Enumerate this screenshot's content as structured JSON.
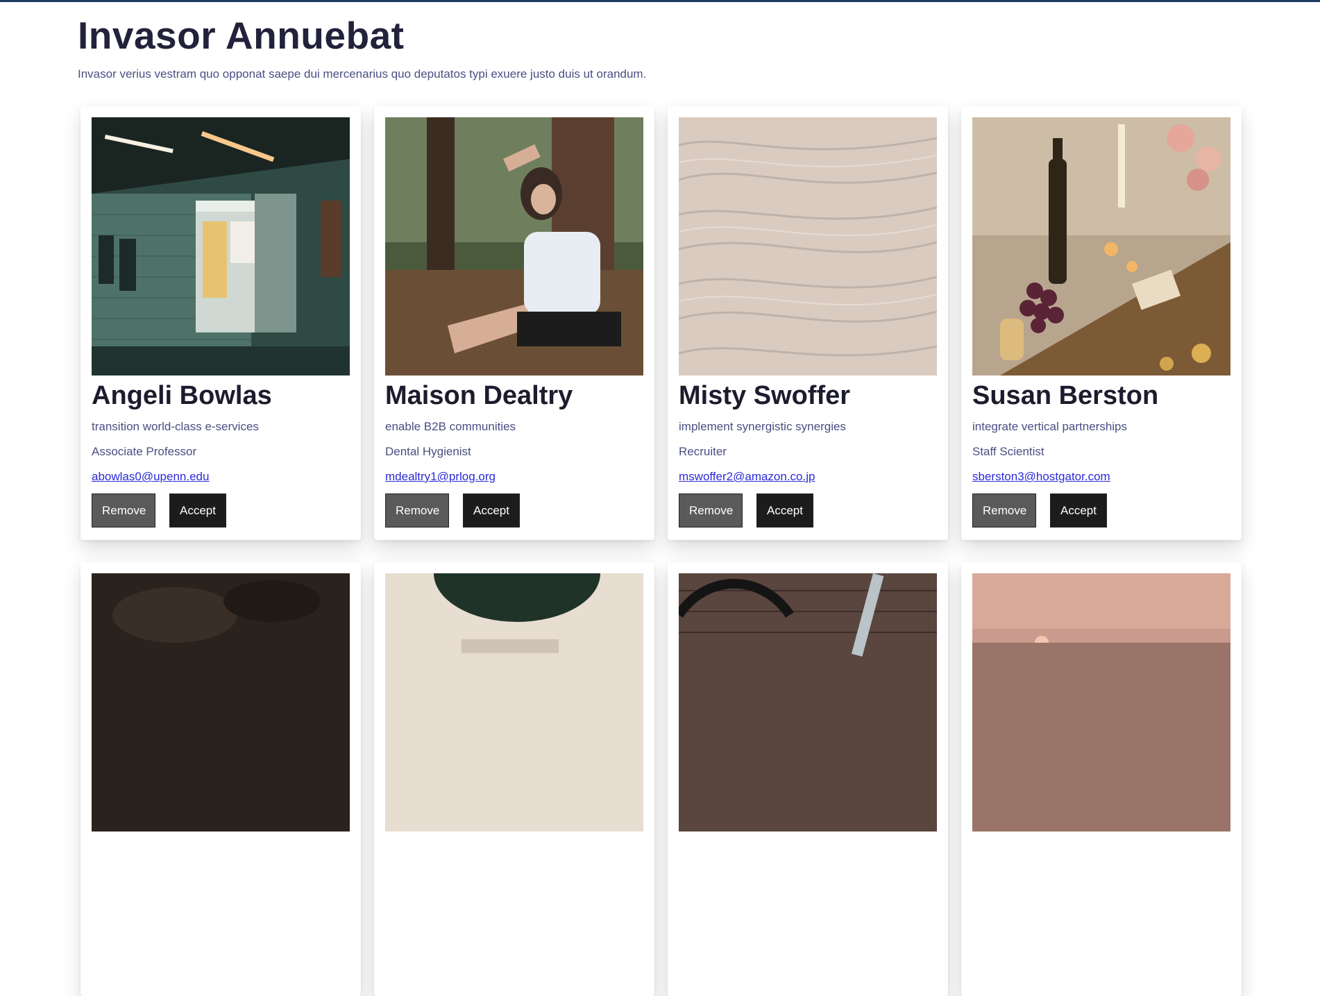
{
  "page": {
    "title": "Invasor Annuebat",
    "subtitle": "Invasor verius vestram quo opponat saepe dui mercenarius quo deputatos typi exuere justo duis ut orandum."
  },
  "cards": [
    {
      "name": "Angeli Bowlas",
      "tagline": "transition world-class e-services",
      "job": "Associate Professor",
      "email": "abowlas0@upenn.edu",
      "remove_label": "Remove",
      "accept_label": "Accept"
    },
    {
      "name": "Maison Dealtry",
      "tagline": "enable B2B communities",
      "job": "Dental Hygienist",
      "email": "mdealtry1@prlog.org",
      "remove_label": "Remove",
      "accept_label": "Accept"
    },
    {
      "name": "Misty Swoffer",
      "tagline": "implement synergistic synergies",
      "job": "Recruiter",
      "email": "mswoffer2@amazon.co.jp",
      "remove_label": "Remove",
      "accept_label": "Accept"
    },
    {
      "name": "Susan Berston",
      "tagline": "integrate vertical partnerships",
      "job": "Staff Scientist",
      "email": "sberston3@hostgator.com",
      "remove_label": "Remove",
      "accept_label": "Accept"
    }
  ],
  "colors": {
    "top_border": "#1f3a63",
    "heading": "#22223b",
    "muted_text": "#4a4e82",
    "link": "#2a2ad8",
    "remove_button": "#5a5a5a",
    "accept_button": "#1c1c1c"
  }
}
